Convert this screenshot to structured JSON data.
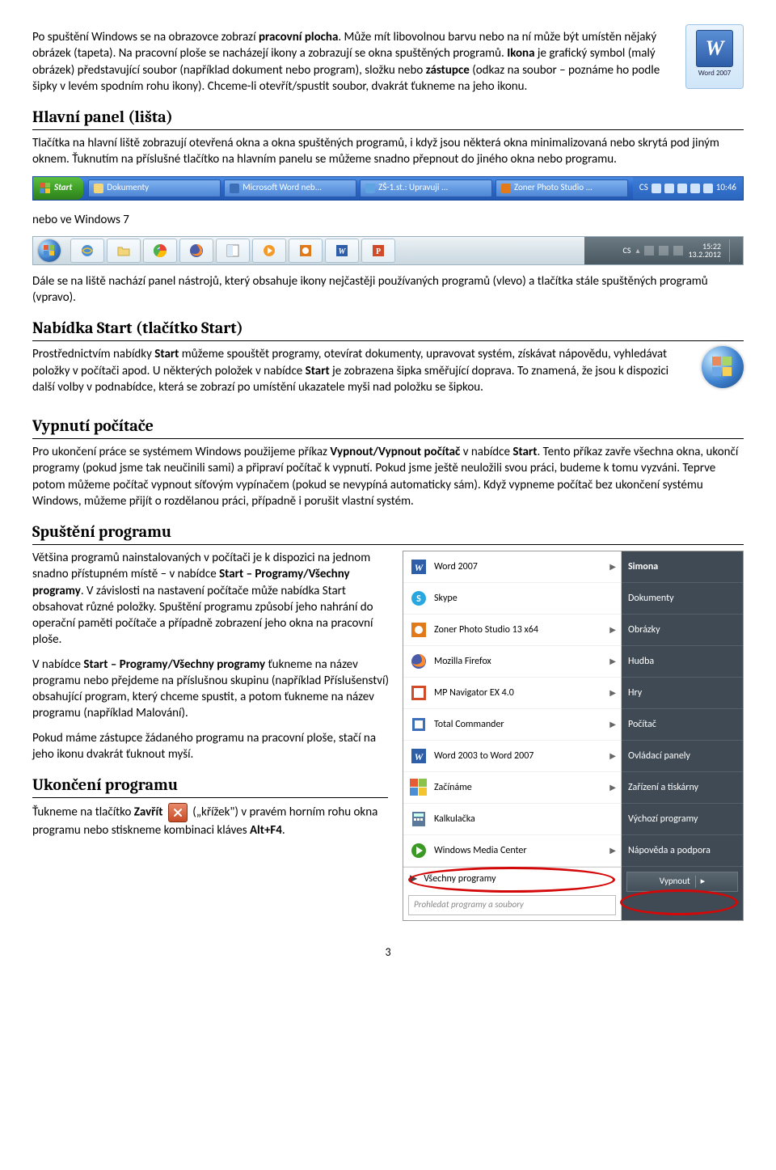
{
  "wordIcon": {
    "letter": "W",
    "caption": "Word 2007"
  },
  "para1_a": "Po spuštění Windows se na obrazovce zobrazí ",
  "para1_b": "pracovní plocha",
  "para1_c": ". Může mít libovolnou barvu nebo na ní může být umístěn nějaký obrázek (tapeta). Na pracovní ploše se nacházejí ikony a zobrazují se okna spuštěných programů. ",
  "para1_d": "Ikona",
  "para1_e": " je grafický symbol (malý obrázek) představující soubor (například dokument nebo program), složku nebo ",
  "para1_f": "zástupce",
  "para1_g": " (odkaz na soubor – poznáme ho podle šipky v levém spodním rohu ikony). Chceme-li otevřít/spustit soubor, dvakrát ťukneme na jeho ikonu.",
  "h_hlavni": "Hlavní panel (lišta)",
  "para2": "Tlačítka na hlavní liště zobrazují otevřená okna a okna spuštěných programů, i když jsou některá okna minimalizovaná nebo skrytá pod jiným oknem. Ťuknutím na příslušné tlačítko na hlavním panelu se můžeme snadno přepnout do jiného okna nebo programu.",
  "xp": {
    "start": "Start",
    "tasks": [
      "Dokumenty",
      "Microsoft Word neb...",
      "ZŠ-1.st.: Upravuji ...",
      "Zoner Photo Studio ..."
    ],
    "lang": "CS",
    "clock": "10:46"
  },
  "nebo": "nebo ve Windows 7",
  "w7": {
    "lang": "CS",
    "time": "15:22",
    "date": "13.2.2012"
  },
  "para3": "Dále se na liště nachází panel nástrojů, který obsahuje ikony nejčastěji používaných programů (vlevo) a tlačítka stále spuštěných programů (vpravo).",
  "h_start": "Nabídka Start (tlačítko Start)",
  "para4_a": "Prostřednictvím nabídky ",
  "para4_b": "Start",
  "para4_c": " můžeme spouštět programy, otevírat dokumenty, upravovat systém, získávat nápovědu, vyhledávat položky v počítači apod. U některých položek v nabídce ",
  "para4_d": "Start",
  "para4_e": " je zobrazena šipka směřující doprava. To znamená, že jsou k dispozici další volby v podnabídce, která se zobrazí po umístění ukazatele myši nad položku se šipkou.",
  "h_vyp": "Vypnutí počítače",
  "para5_a": "Pro ukončení práce se systémem Windows použijeme příkaz ",
  "para5_b": "Vypnout/Vypnout počítač",
  "para5_c": " v nabídce ",
  "para5_d": "Start",
  "para5_e": ". Tento příkaz zavře všechna okna, ukončí programy (pokud jsme tak neučinili sami) a připraví počítač k vypnutí. Pokud jsme ještě neuložili svou práci, budeme k tomu vyzváni. Teprve potom můžeme počítač vypnout síťovým vypínačem (pokud se nevypíná automaticky sám). Když vypneme počítač bez ukončení systému Windows, můžeme přijít o rozdělanou práci, případně i porušit vlastní systém.",
  "h_spust": "Spuštění programu",
  "para6_a": "Většina programů nainstalovaných v počítači je k dispozici na jednom snadno přístupném místě – v nabídce ",
  "para6_b": "Start – Programy/Všechny programy",
  "para6_c": ". V závislosti na nastavení počítače může nabídka Start obsahovat různé položky. Spuštění programu způsobí jeho nahrání do operační paměti počítače a případně zobrazení jeho okna na pracovní ploše.",
  "para7_a": "V nabídce ",
  "para7_b": "Start – Programy/Všechny programy",
  "para7_c": " ťukneme na název programu nebo přejdeme na příslušnou skupinu (například Příslušenství) obsahující program, který chceme spustit, a potom ťukneme na název programu (například Malování).",
  "para8": "Pokud máme zástupce žádaného programu na pracovní ploše, stačí na jeho ikonu dvakrát ťuknout myší.",
  "h_ukon": "Ukončení programu",
  "para9_a": "Ťukneme na tlačítko ",
  "para9_b": "Zavřít",
  "para9_c": " („křížek\") v pravém horním rohu okna programu nebo stiskneme kombinaci kláves ",
  "para9_d": "Alt+F4",
  "para9_e": ".",
  "startMenu": {
    "left": [
      {
        "label": "Word 2007",
        "icon": "word",
        "arrow": true
      },
      {
        "label": "Skype",
        "icon": "skype",
        "arrow": false
      },
      {
        "label": "Zoner Photo Studio 13 x64",
        "icon": "zps",
        "arrow": true
      },
      {
        "label": "Mozilla Firefox",
        "icon": "ff",
        "arrow": true
      },
      {
        "label": "MP Navigator EX 4.0",
        "icon": "mp",
        "arrow": true
      },
      {
        "label": "Total Commander",
        "icon": "tc",
        "arrow": true
      },
      {
        "label": "Word 2003 to Word 2007",
        "icon": "word",
        "arrow": true
      },
      {
        "label": "Začínáme",
        "icon": "flag",
        "arrow": true
      },
      {
        "label": "Kalkulačka",
        "icon": "calc",
        "arrow": false
      },
      {
        "label": "Windows Media Center",
        "icon": "wmc",
        "arrow": true
      }
    ],
    "allprog": "Všechny programy",
    "search": "Prohledat programy a soubory",
    "right": [
      "Simona",
      "Dokumenty",
      "Obrázky",
      "Hudba",
      "Hry",
      "Počítač",
      "Ovládací panely",
      "Zařízení a tiskárny",
      "Výchozí programy",
      "Nápověda a podpora"
    ],
    "shutdown": "Vypnout"
  },
  "pageNum": "3"
}
